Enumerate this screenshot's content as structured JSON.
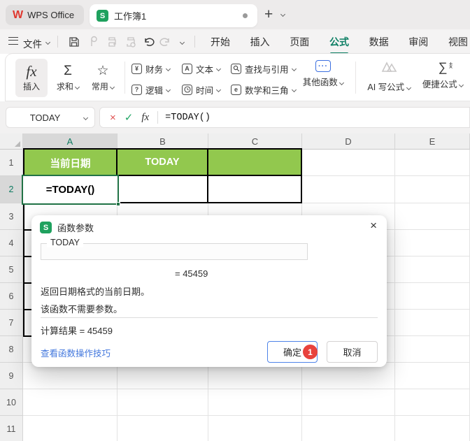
{
  "titlebar": {
    "app": "WPS Office",
    "doc_tab": "工作簿1"
  },
  "menubar": {
    "menu": "文件",
    "tabs": [
      {
        "label": "开始"
      },
      {
        "label": "插入"
      },
      {
        "label": "页面"
      },
      {
        "label": "公式"
      },
      {
        "label": "数据"
      },
      {
        "label": "审阅"
      },
      {
        "label": "视图"
      }
    ]
  },
  "ribbon": {
    "insert_function": {
      "glyph": "fx",
      "label": "插入"
    },
    "sum": {
      "glyph": "Σ",
      "label": "求和"
    },
    "common": {
      "glyph": "☆",
      "label": "常用"
    },
    "categories": [
      {
        "icon": "¥",
        "label": "财务"
      },
      {
        "icon": "A",
        "label": "文本"
      },
      {
        "icon": "Q",
        "label": "查找与引用"
      },
      {
        "icon": "?",
        "label": "逻辑"
      },
      {
        "icon": "O",
        "label": "时间"
      },
      {
        "icon": "e",
        "label": "数学和三角"
      }
    ],
    "other_functions": {
      "icon": "···",
      "label": "其他函数"
    },
    "ai_formula": {
      "label": "AI 写公式"
    },
    "quick_formula": {
      "glyph": "∑",
      "plus": "+",
      "times": "×",
      "label": "便捷公式"
    }
  },
  "formula_bar": {
    "name_box": "TODAY",
    "formula": "=TODAY()"
  },
  "grid": {
    "columns": [
      "A",
      "B",
      "C",
      "D",
      "E"
    ],
    "rows": [
      "1",
      "2",
      "3",
      "4",
      "5",
      "6",
      "7",
      "8",
      "9",
      "10",
      "11"
    ],
    "selected_column": "A",
    "selected_row": "2",
    "cells": {
      "a1": "当前日期",
      "b1": "TODAY",
      "c1": "",
      "a2": "=TODAY()",
      "b2": "",
      "c2": ""
    }
  },
  "dialog": {
    "title": "函数参数",
    "icon_letter": "S",
    "function_name": "TODAY",
    "preview": "=  45459",
    "description": "返回日期格式的当前日期。",
    "note": "该函数不需要参数。",
    "result": "计算结果  =  45459",
    "tips_link": "查看函数操作技巧",
    "ok": "确定",
    "cancel": "取消",
    "badge": "1",
    "close": "×"
  },
  "colors": {
    "accent_teal": "#0b7e63",
    "table_green": "#92c84e",
    "selection_green": "#217346",
    "badge_red": "#e8423d",
    "link_blue": "#4277dd",
    "ok_border": "#4e83e8",
    "wps_red": "#e0372e",
    "s_icon_green": "#1fa15e"
  }
}
